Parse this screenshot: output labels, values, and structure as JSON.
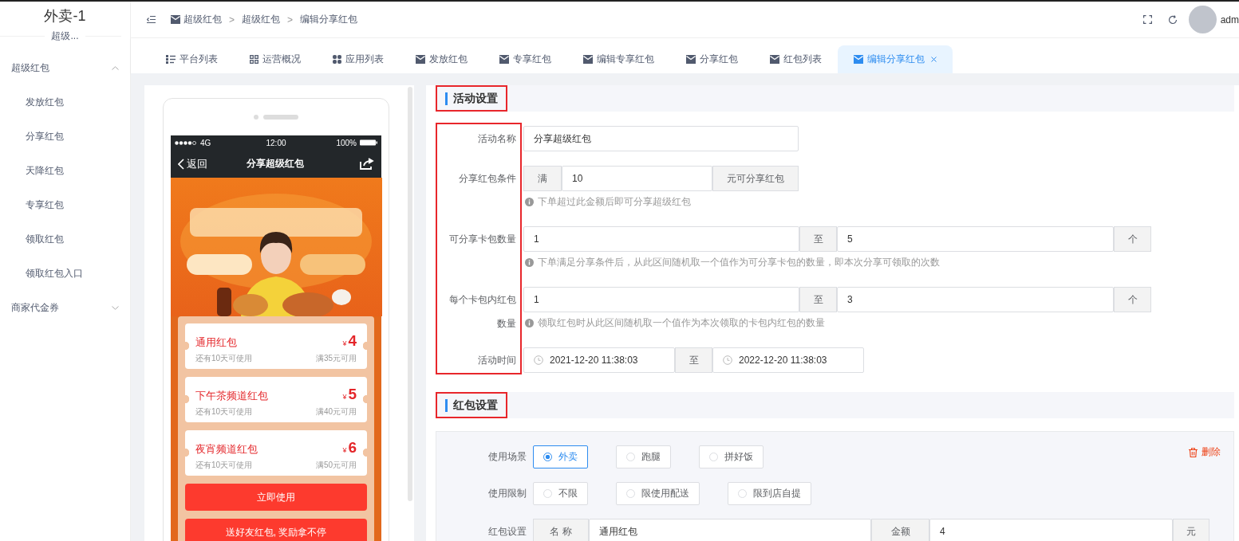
{
  "sidebar": {
    "title": "外卖-1",
    "subtitle": "超级...",
    "menu": [
      {
        "label": "超级红包",
        "expanded": true,
        "children": [
          {
            "label": "发放红包",
            "selected": false
          },
          {
            "label": "分享红包",
            "selected": false
          },
          {
            "label": "天降红包",
            "selected": false
          },
          {
            "label": "专享红包",
            "selected": false
          },
          {
            "label": "领取红包",
            "selected": false
          },
          {
            "label": "领取红包入口",
            "selected": false
          }
        ]
      },
      {
        "label": "商家代金券",
        "expanded": false
      }
    ]
  },
  "header": {
    "breadcrumb": [
      {
        "label": "超级红包",
        "separator": ">"
      },
      {
        "label": "超级红包",
        "separator": ">"
      },
      {
        "label": "编辑分享红包"
      }
    ],
    "user": "adm"
  },
  "tabs": [
    {
      "label": "平台列表",
      "kind": "list",
      "selected": false
    },
    {
      "label": "运营概况",
      "kind": "grid",
      "selected": false
    },
    {
      "label": "应用列表",
      "kind": "apps",
      "selected": false
    },
    {
      "label": "发放红包",
      "kind": "envelope",
      "selected": false
    },
    {
      "label": "专享红包",
      "kind": "envelope",
      "selected": false
    },
    {
      "label": "编辑专享红包",
      "kind": "envelope",
      "selected": false
    },
    {
      "label": "分享红包",
      "kind": "envelope",
      "selected": false
    },
    {
      "label": "红包列表",
      "kind": "envelope",
      "selected": false
    },
    {
      "label": "编辑分享红包",
      "kind": "envelope",
      "selected": true
    }
  ],
  "preview": {
    "status": {
      "network": "4G",
      "time": "12:00",
      "battery": "100%"
    },
    "nav": {
      "back": "返回",
      "title": "分享超级红包"
    },
    "banner": {
      "kind": "picture"
    },
    "coupons": [
      {
        "name": "通用红包",
        "currency": "¥",
        "amount": "4",
        "validity": "还有10天可使用",
        "condition": "满35元可用"
      },
      {
        "name": "下午茶频道红包",
        "currency": "¥",
        "amount": "5",
        "validity": "还有10天可使用",
        "condition": "满40元可用"
      },
      {
        "name": "夜宵频道红包",
        "currency": "¥",
        "amount": "6",
        "validity": "还有10天可使用",
        "condition": "满50元可用"
      }
    ],
    "buttons": [
      "立即使用",
      "送好友红包, 奖励拿不停"
    ]
  },
  "activity": {
    "title": "活动设置",
    "annotated": true,
    "labels_annotated": true,
    "fields": [
      {
        "kind": "text",
        "label": "活动名称",
        "value": "分享超级红包"
      },
      {
        "kind": "addon",
        "label": "分享红包条件",
        "prefix": "满",
        "value": "10",
        "suffix": "元可分享红包",
        "help": "下单超过此金额后即可分享超级红包"
      },
      {
        "kind": "range",
        "label": "可分享卡包数量",
        "from": "1",
        "separator": "至",
        "to": "5",
        "unit": "个",
        "help": "下单满足分享条件后，从此区间随机取一个值作为可分享卡包的数量，即本次分享可领取的次数"
      },
      {
        "kind": "range",
        "label": "每个卡包内红包数量",
        "from": "1",
        "separator": "至",
        "to": "3",
        "unit": "个",
        "help": "领取红包时从此区间随机取一个值作为本次领取的卡包内红包的数量"
      },
      {
        "kind": "daterange",
        "label": "活动时间",
        "from": "2021-12-20 11:38:03",
        "separator": "至",
        "to": "2022-12-20 11:38:03"
      }
    ]
  },
  "packet": {
    "title": "红包设置",
    "annotated": true,
    "delete": "删除",
    "rows": [
      {
        "kind": "radio",
        "label": "使用场景",
        "options": [
          {
            "label": "外卖",
            "selected": true
          },
          {
            "label": "跑腿",
            "selected": false
          },
          {
            "label": "拼好饭",
            "selected": false
          }
        ]
      },
      {
        "kind": "radio",
        "label": "使用限制",
        "options": [
          {
            "label": "不限",
            "selected": false
          },
          {
            "label": "限使用配送",
            "selected": false
          },
          {
            "label": "限到店自提",
            "selected": false
          }
        ]
      },
      {
        "kind": "packet",
        "label": "红包设置",
        "name_label": "名 称",
        "name": "通用红包",
        "amount_label": "金额",
        "amount": "4",
        "unit": "元"
      }
    ]
  }
}
